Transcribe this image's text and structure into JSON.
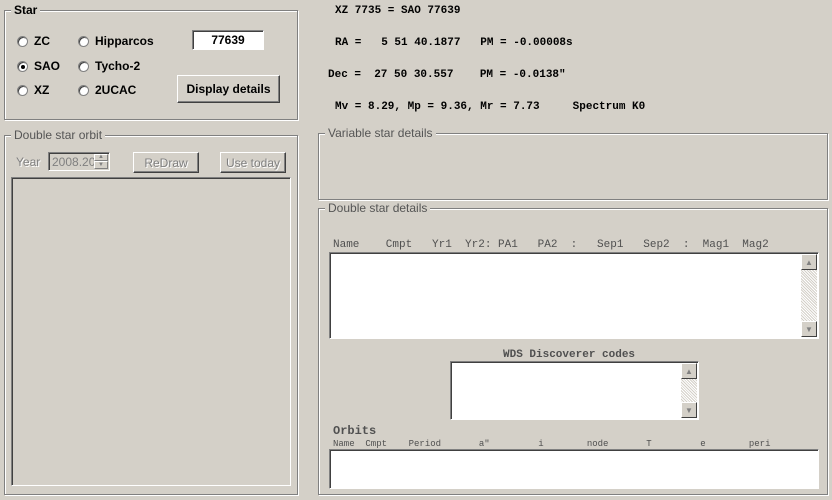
{
  "star_panel": {
    "title": "Star",
    "radios": [
      {
        "label": "ZC",
        "checked": false
      },
      {
        "label": "Hipparcos",
        "checked": false
      },
      {
        "label": "SAO",
        "checked": true
      },
      {
        "label": "Tycho-2",
        "checked": false
      },
      {
        "label": "XZ",
        "checked": false
      },
      {
        "label": "2UCAC",
        "checked": false
      }
    ],
    "star_number": "77639",
    "display_button": "Display details"
  },
  "info": {
    "line1": "XZ 7735 = SAO 77639",
    "ra": "RA =   5 51 40.1877   PM = -0.00008s",
    "dec": "Dec =  27 50 30.557    PM = -0.0138\"",
    "mags": "Mv = 8.29, Mp = 9.36, Mr = 7.73     Spectrum K0"
  },
  "orbit_panel": {
    "title": "Double star orbit",
    "year_label": "Year",
    "year_value": "2008.20",
    "redraw_button": "ReDraw",
    "use_today_button": "Use today"
  },
  "variable_panel": {
    "title": "Variable star details"
  },
  "double_panel": {
    "title": "Double star details",
    "header": "Name    Cmpt   Yr1  Yr2: PA1   PA2  :   Sep1   Sep2  :  Mag1  Mag2",
    "wds_label": "WDS Discoverer codes",
    "orbits_label": "Orbits",
    "orbits_header": "Name  Cmpt    Period       a\"         i        node       T         e        peri"
  }
}
